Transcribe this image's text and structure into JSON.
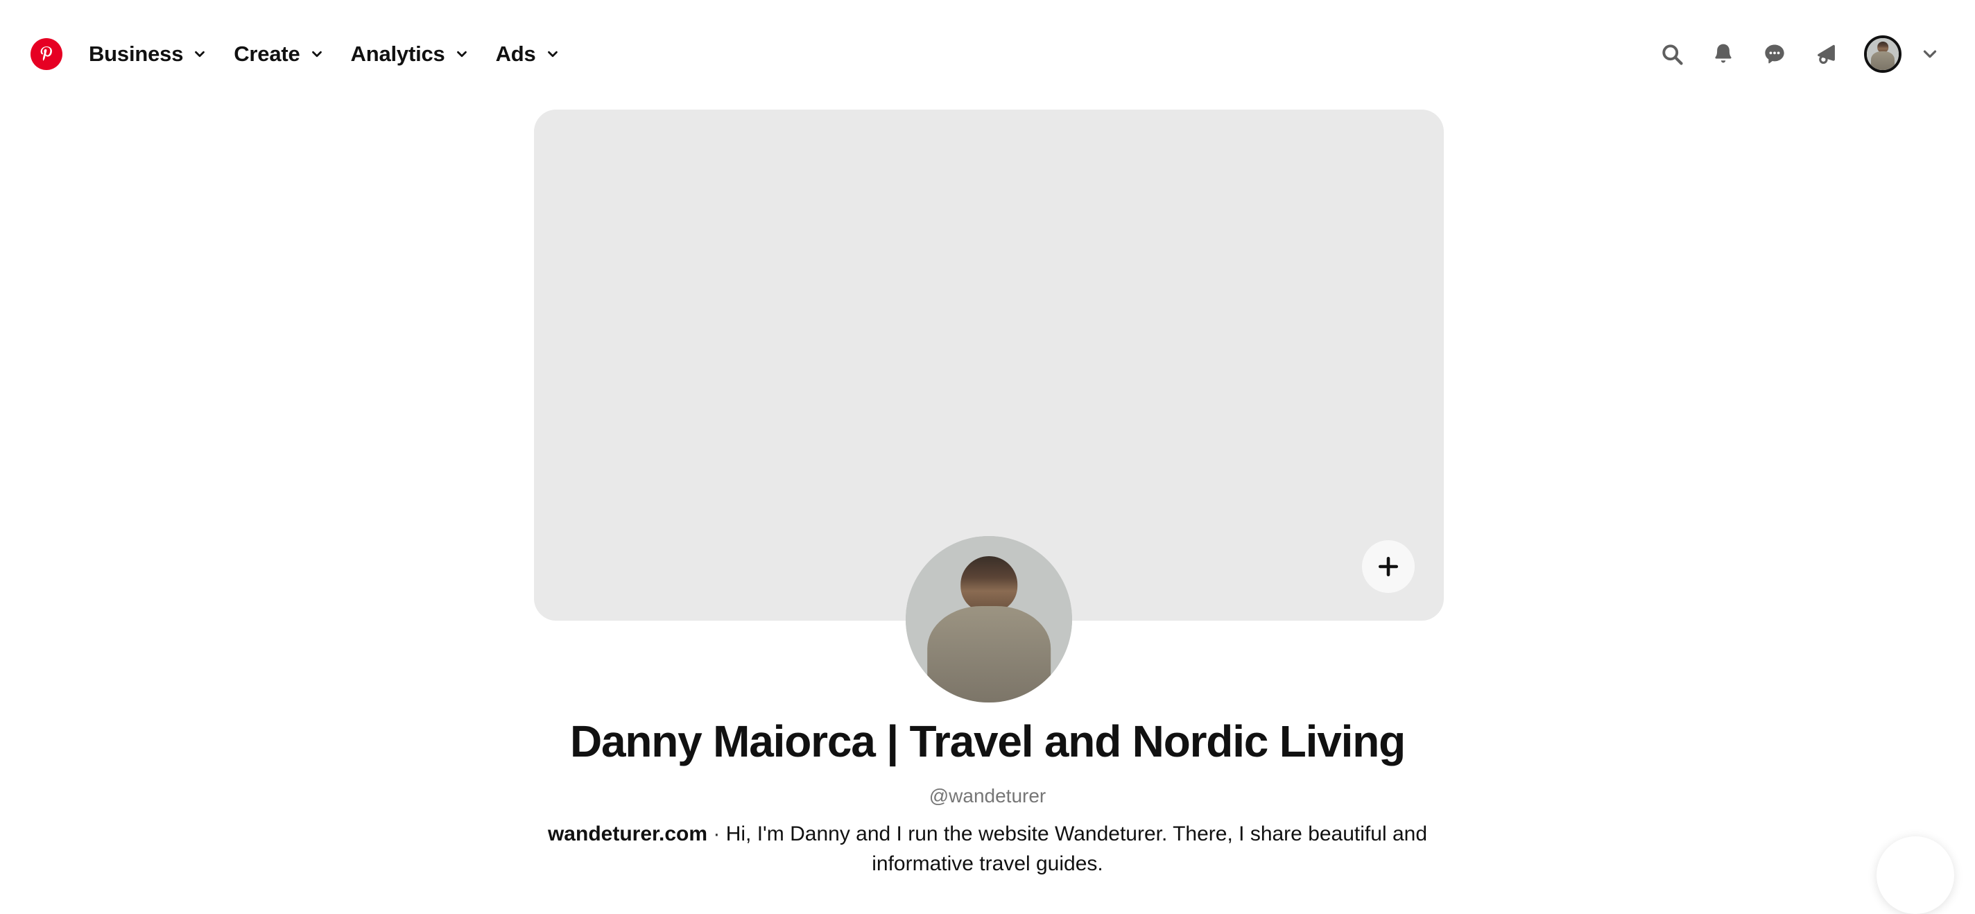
{
  "brand": {
    "name": "Pinterest",
    "logo_icon": "pinterest-logo-icon",
    "accent_color": "#E60023"
  },
  "header": {
    "nav": [
      {
        "label": "Business",
        "icon": "chevron-down-icon"
      },
      {
        "label": "Create",
        "icon": "chevron-down-icon"
      },
      {
        "label": "Analytics",
        "icon": "chevron-down-icon"
      },
      {
        "label": "Ads",
        "icon": "chevron-down-icon"
      }
    ],
    "actions": [
      {
        "icon": "search-icon"
      },
      {
        "icon": "bell-icon"
      },
      {
        "icon": "messages-icon"
      },
      {
        "icon": "megaphone-icon"
      }
    ],
    "account": {
      "avatar_icon": "avatar",
      "menu_icon": "chevron-down-icon"
    }
  },
  "cover": {
    "add_button_label": "+",
    "add_button_icon": "plus-icon",
    "background_color": "#E9E9E9"
  },
  "profile": {
    "name": "Danny Maiorca | Travel and Nordic Living",
    "handle": "@wandeturer",
    "website": "wandeturer.com",
    "separator": "·",
    "bio": "Hi, I'm Danny and I run the website Wandeturer. There, I share beautiful and informative travel guides."
  },
  "help": {
    "icon": "help-fab-icon"
  }
}
